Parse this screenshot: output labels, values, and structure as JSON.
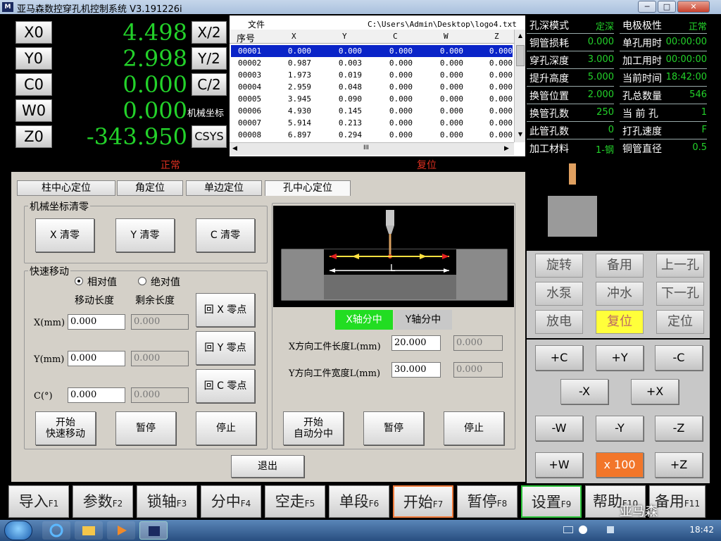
{
  "window": {
    "title": "亚马森数控穿孔机控制系统 V3.191226i",
    "logo": "M",
    "buttons": [
      "─",
      "□",
      "✕"
    ]
  },
  "coords": {
    "rows": [
      {
        "axis": "X0",
        "value": "4.498",
        "right": "X/2"
      },
      {
        "axis": "Y0",
        "value": "2.998",
        "right": "Y/2"
      },
      {
        "axis": "C0",
        "value": "0.000",
        "right": "C/2"
      },
      {
        "axis": "W0",
        "value": "0.000",
        "right": "机械坐标"
      },
      {
        "axis": "Z0",
        "value": "-343.950",
        "right": "CSYS"
      }
    ]
  },
  "file": {
    "label": "文件",
    "path": "C:\\Users\\Admin\\Desktop\\logo4.txt",
    "columns": [
      "序号",
      "X",
      "Y",
      "C",
      "W",
      "Z"
    ],
    "rows": [
      [
        "00001",
        "0.000",
        "0.000",
        "0.000",
        "0.000",
        "0.000"
      ],
      [
        "00002",
        "0.987",
        "0.003",
        "0.000",
        "0.000",
        "0.000"
      ],
      [
        "00003",
        "1.973",
        "0.019",
        "0.000",
        "0.000",
        "0.000"
      ],
      [
        "00004",
        "2.959",
        "0.048",
        "0.000",
        "0.000",
        "0.000"
      ],
      [
        "00005",
        "3.945",
        "0.090",
        "0.000",
        "0.000",
        "0.000"
      ],
      [
        "00006",
        "4.930",
        "0.145",
        "0.000",
        "0.000",
        "0.000"
      ],
      [
        "00007",
        "5.914",
        "0.213",
        "0.000",
        "0.000",
        "0.000"
      ],
      [
        "00008",
        "6.897",
        "0.294",
        "0.000",
        "0.000",
        "0.000"
      ]
    ],
    "scroll_mid": "III"
  },
  "status": {
    "left": [
      {
        "label": "孔深模式",
        "value": "定深"
      },
      {
        "label": "铜管损耗",
        "value": "0.000"
      },
      {
        "label": "穿孔深度",
        "value": "3.000"
      },
      {
        "label": "提升高度",
        "value": "5.000"
      },
      {
        "label": "换管位置",
        "value": "2.000"
      },
      {
        "label": "换管孔数",
        "value": "250"
      },
      {
        "label": "此管孔数",
        "value": "0"
      },
      {
        "label": "加工材料",
        "value": "1-钢"
      }
    ],
    "right": [
      {
        "label": "电极极性",
        "value": "正常"
      },
      {
        "label": "单孔用时",
        "value": "00:00:00"
      },
      {
        "label": "加工用时",
        "value": "00:00:00"
      },
      {
        "label": "当前时间",
        "value": "18:42:00"
      },
      {
        "label": "孔总数量",
        "value": "546"
      },
      {
        "label": "当 前 孔",
        "value": "1"
      },
      {
        "label": "打孔速度",
        "value": "F"
      },
      {
        "label": "铜管直径",
        "value": "0.5"
      }
    ]
  },
  "banner": {
    "left": "正常",
    "right": "复位"
  },
  "tabs": [
    "柱中心定位",
    "角定位",
    "单边定位",
    "孔中心定位"
  ],
  "mech_zero": {
    "title": "机械坐标清零",
    "buttons": [
      "X 清零",
      "Y 清零",
      "C 清零"
    ]
  },
  "fast_move": {
    "title": "快速移动",
    "radio_rel": "相对值",
    "radio_abs": "绝对值",
    "col1": "移动长度",
    "col2": "剩余长度",
    "rows": [
      {
        "label": "X(mm)",
        "move": "0.000",
        "remain": "0.000",
        "zero_btn": "回 X 零点"
      },
      {
        "label": "Y(mm)",
        "move": "0.000",
        "remain": "0.000",
        "zero_btn": "回 Y 零点"
      },
      {
        "label": "C(°)",
        "move": "0.000",
        "remain": "0.000",
        "zero_btn": "回 C 零点"
      }
    ],
    "start": "开始\n快速移动",
    "pause": "暂停",
    "stop": "停止"
  },
  "center": {
    "diagram_label": "L",
    "x_tab": "X轴分中",
    "y_tab": "Y轴分中",
    "x_label": "X方向工件长度L(mm)",
    "x_value": "20.000",
    "x_ro": "0.000",
    "y_label": "Y方向工件宽度L(mm)",
    "y_value": "30.000",
    "y_ro": "0.000",
    "start": "开始\n自动分中",
    "pause": "暂停",
    "stop": "停止"
  },
  "exit": "退出",
  "func_buttons": [
    {
      "label": "旋转",
      "hl": false
    },
    {
      "label": "备用",
      "hl": false
    },
    {
      "label": "上一孔",
      "hl": false
    },
    {
      "label": "水泵",
      "hl": false
    },
    {
      "label": "冲水",
      "hl": false
    },
    {
      "label": "下一孔",
      "hl": false
    },
    {
      "label": "放电",
      "hl": false
    },
    {
      "label": "复位",
      "hl": true
    },
    {
      "label": "定位",
      "hl": false
    }
  ],
  "jog": {
    "r1": [
      "+C",
      "+Y",
      "-C"
    ],
    "r2": [
      "-X",
      "+X"
    ],
    "r3": [
      "-W",
      "-Y",
      "-Z"
    ],
    "r4": [
      "+W",
      "x 100",
      "+Z"
    ]
  },
  "fkeys": [
    {
      "label": "导入",
      "key": "F1"
    },
    {
      "label": "参数",
      "key": "F2"
    },
    {
      "label": "锁轴",
      "key": "F3"
    },
    {
      "label": "分中",
      "key": "F4"
    },
    {
      "label": "空走",
      "key": "F5"
    },
    {
      "label": "单段",
      "key": "F6"
    },
    {
      "label": "开始",
      "key": "F7"
    },
    {
      "label": "暂停",
      "key": "F8"
    },
    {
      "label": "设置",
      "key": "F9"
    },
    {
      "label": "帮助",
      "key": "F10"
    },
    {
      "label": "备用",
      "key": "F11"
    }
  ],
  "watermark": "亚马森",
  "taskbar": {
    "time": "18:42"
  },
  "colors": {
    "green": "#23d22a",
    "red": "#e03020",
    "selected_row": "#0a24c8",
    "highlight": "#ffff3a",
    "orange": "#f2762a"
  }
}
